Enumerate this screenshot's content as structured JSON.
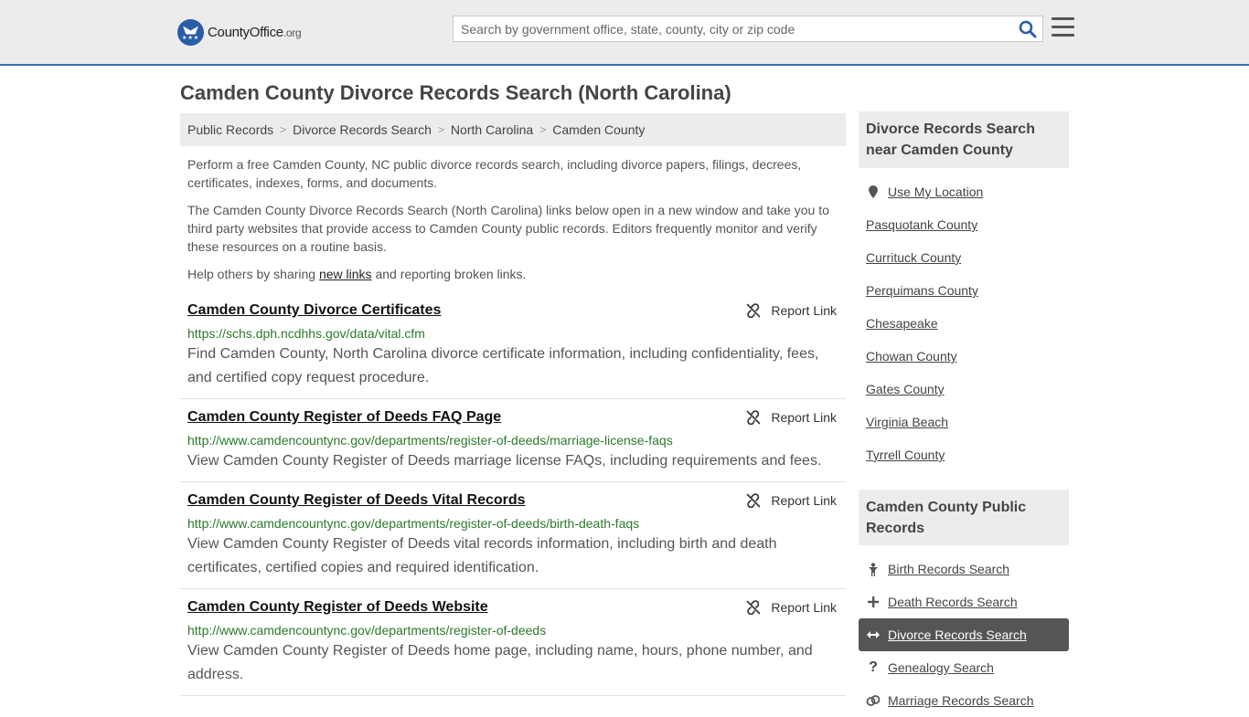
{
  "header": {
    "logo_brand": "CountyOffice",
    "logo_tld": ".org",
    "search_placeholder": "Search by government office, state, county, city or zip code"
  },
  "page_title": "Camden County Divorce Records Search (North Carolina)",
  "breadcrumb": [
    "Public Records",
    "Divorce Records Search",
    "North Carolina",
    "Camden County"
  ],
  "intro": {
    "p1": "Perform a free Camden County, NC public divorce records search, including divorce papers, filings, decrees, certificates, indexes, forms, and documents.",
    "p2": "The Camden County Divorce Records Search (North Carolina) links below open in a new window and take you to third party websites that provide access to Camden County public records. Editors frequently monitor and verify these resources on a routine basis.",
    "p3_before": "Help others by sharing ",
    "p3_link": "new links",
    "p3_after": " and reporting broken links."
  },
  "report_label": "Report Link",
  "results": [
    {
      "title": "Camden County Divorce Certificates",
      "url": "https://schs.dph.ncdhhs.gov/data/vital.cfm",
      "desc": "Find Camden County, North Carolina divorce certificate information, including confidentiality, fees, and certified copy request procedure."
    },
    {
      "title": "Camden County Register of Deeds FAQ Page",
      "url": "http://www.camdencountync.gov/departments/register-of-deeds/marriage-license-faqs",
      "desc": "View Camden County Register of Deeds marriage license FAQs, including requirements and fees."
    },
    {
      "title": "Camden County Register of Deeds Vital Records",
      "url": "http://www.camdencountync.gov/departments/register-of-deeds/birth-death-faqs",
      "desc": "View Camden County Register of Deeds vital records information, including birth and death certificates, certified copies and required identification."
    },
    {
      "title": "Camden County Register of Deeds Website",
      "url": "http://www.camdencountync.gov/departments/register-of-deeds",
      "desc": "View Camden County Register of Deeds home page, including name, hours, phone number, and address."
    }
  ],
  "sidebar": {
    "nearby_heading": "Divorce Records Search near Camden County",
    "use_location": "Use My Location",
    "nearby": [
      "Pasquotank County",
      "Currituck County",
      "Perquimans County",
      "Chesapeake",
      "Chowan County",
      "Gates County",
      "Virginia Beach",
      "Tyrrell County"
    ],
    "public_heading": "Camden County Public Records",
    "public_links": [
      {
        "label": "Birth Records Search",
        "icon": "child-icon"
      },
      {
        "label": "Death Records Search",
        "icon": "cross-icon"
      },
      {
        "label": "Divorce Records Search",
        "icon": "split-arrows-icon",
        "active": true
      },
      {
        "label": "Genealogy Search",
        "icon": "question-icon"
      },
      {
        "label": "Marriage Records Search",
        "icon": "rings-icon"
      }
    ]
  },
  "colors": {
    "accent_blue": "#3a70b1",
    "url_green": "#2b7a2b",
    "active_bg": "#555555"
  }
}
